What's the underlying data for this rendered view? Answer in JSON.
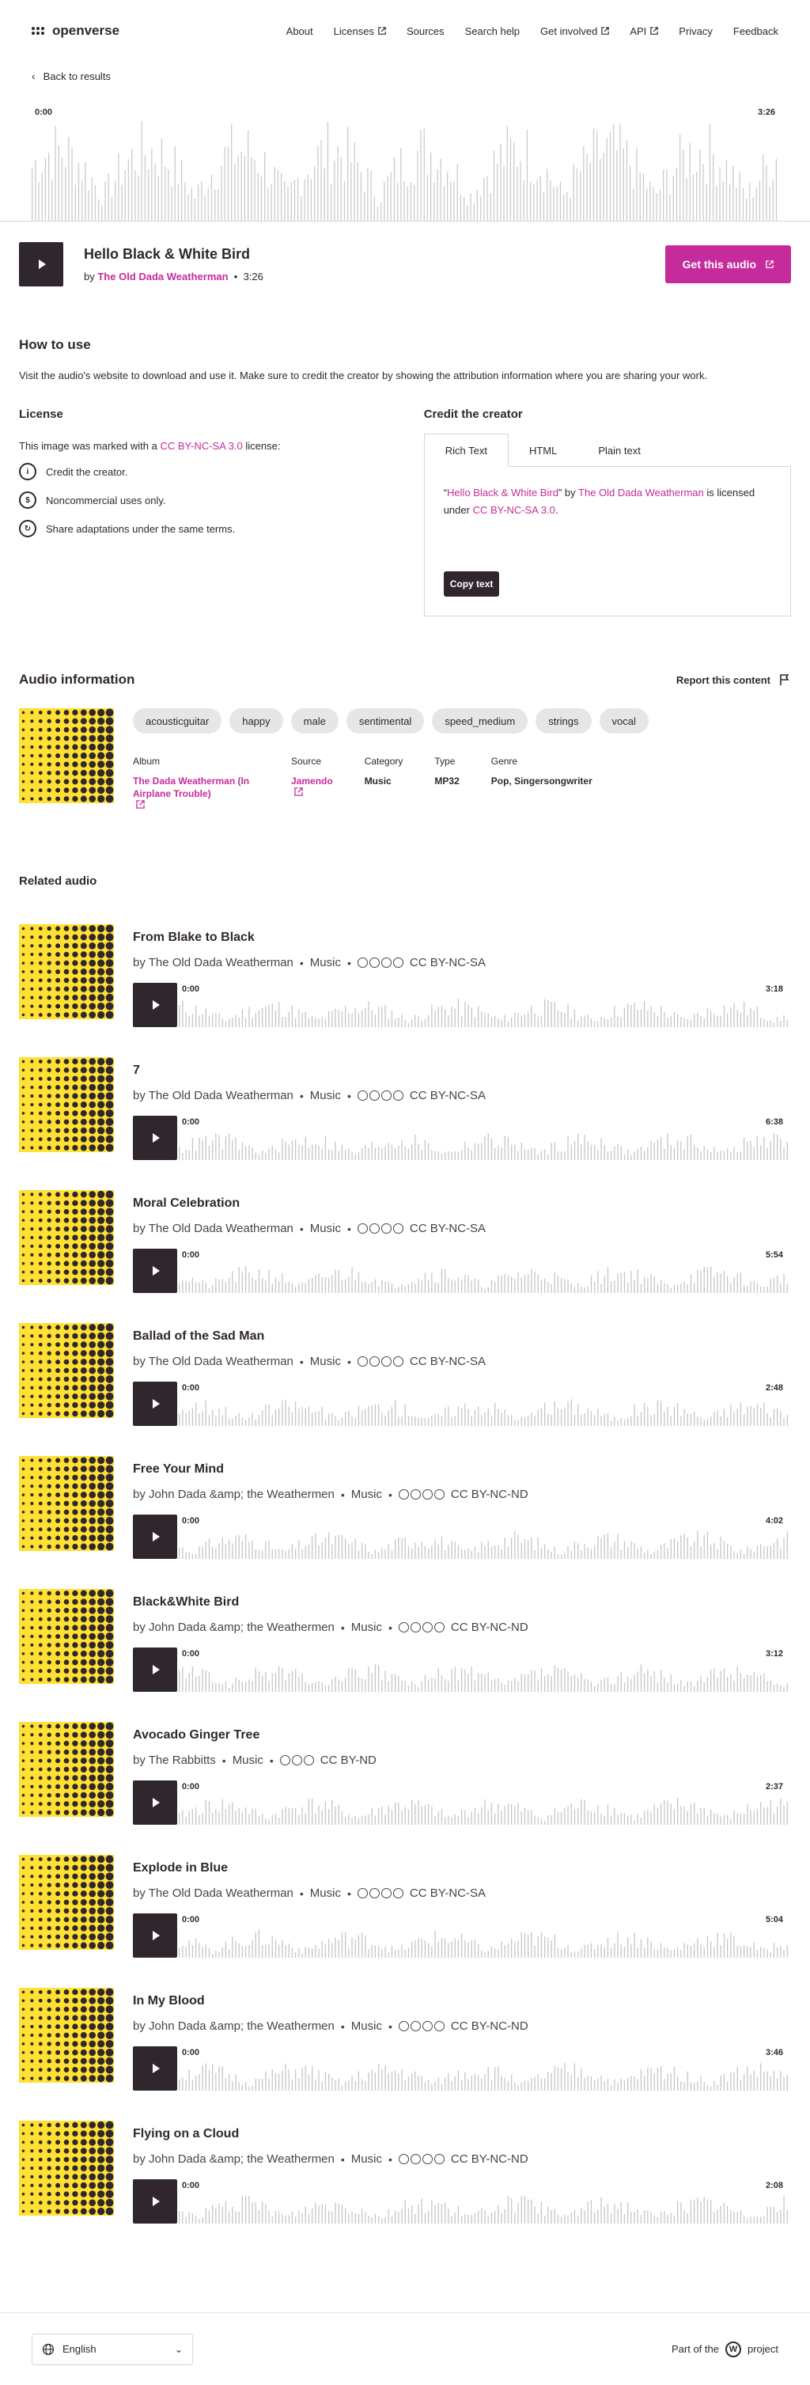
{
  "header": {
    "logo_text": "openverse",
    "nav": [
      {
        "label": "About",
        "external": false
      },
      {
        "label": "Licenses",
        "external": true
      },
      {
        "label": "Sources",
        "external": false
      },
      {
        "label": "Search help",
        "external": false
      },
      {
        "label": "Get involved",
        "external": true
      },
      {
        "label": "API",
        "external": true
      },
      {
        "label": "Privacy",
        "external": false
      },
      {
        "label": "Feedback",
        "external": false
      }
    ]
  },
  "back_label": "Back to results",
  "player": {
    "current_time": "0:00",
    "duration": "3:26"
  },
  "track": {
    "title": "Hello Black & White Bird",
    "by": "by",
    "creator": "The Old Dada Weatherman",
    "separator": "•",
    "duration": "3:26",
    "get_button": "Get this audio"
  },
  "how_to_use": {
    "heading": "How to use",
    "text": "Visit the audio's website to download and use it. Make sure to credit the creator by showing the attribution information where you are sharing your work."
  },
  "license": {
    "heading": "License",
    "text_before": "This image was marked with a",
    "license_name": "CC BY-NC-SA 3.0",
    "text_after": "license:",
    "terms": [
      {
        "icon": "by-icon",
        "glyph": "i",
        "text": "Credit the creator."
      },
      {
        "icon": "nc-icon",
        "glyph": "$",
        "text": "Noncommercial uses only."
      },
      {
        "icon": "sa-icon",
        "glyph": "↻",
        "text": "Share adaptations under the same terms."
      }
    ]
  },
  "credit": {
    "heading": "Credit the creator",
    "tabs": [
      "Rich Text",
      "HTML",
      "Plain text"
    ],
    "active_tab": "Rich Text",
    "quote_open": "“",
    "title": "Hello Black & White Bird",
    "quote_close": "”",
    "by": "by",
    "creator": "The Old Dada Weatherman",
    "licensed_under": "is licensed under",
    "license": "CC BY-NC-SA 3.0",
    "period": ".",
    "copy_button": "Copy text"
  },
  "audio_info": {
    "heading": "Audio information",
    "report": "Report this content",
    "tags": [
      "acousticguitar",
      "happy",
      "male",
      "sentimental",
      "speed_medium",
      "strings",
      "vocal"
    ],
    "meta": [
      {
        "label": "Album",
        "value": "The Dada Weatherman (In Airplane Trouble)",
        "link": true
      },
      {
        "label": "Source",
        "value": "Jamendo",
        "link": true
      },
      {
        "label": "Category",
        "value": "Music",
        "link": false
      },
      {
        "label": "Type",
        "value": "MP32",
        "link": false
      },
      {
        "label": "Genre",
        "value": "Pop, Singersongwriter",
        "link": false
      }
    ]
  },
  "related": {
    "heading": "Related audio",
    "items": [
      {
        "title": "From Blake to Black",
        "artist": "by The Old Dada Weatherman",
        "category": "Music",
        "license": "CC BY-NC-SA",
        "icons": 4,
        "start": "0:00",
        "duration": "3:18"
      },
      {
        "title": "7",
        "artist": "by The Old Dada Weatherman",
        "category": "Music",
        "license": "CC BY-NC-SA",
        "icons": 4,
        "start": "0:00",
        "duration": "6:38"
      },
      {
        "title": "Moral Celebration",
        "artist": "by The Old Dada Weatherman",
        "category": "Music",
        "license": "CC BY-NC-SA",
        "icons": 4,
        "start": "0:00",
        "duration": "5:54"
      },
      {
        "title": "Ballad of the Sad Man",
        "artist": "by The Old Dada Weatherman",
        "category": "Music",
        "license": "CC BY-NC-SA",
        "icons": 4,
        "start": "0:00",
        "duration": "2:48"
      },
      {
        "title": "Free Your Mind",
        "artist": "by John Dada &amp; the Weathermen",
        "category": "Music",
        "license": "CC BY-NC-ND",
        "icons": 4,
        "start": "0:00",
        "duration": "4:02"
      },
      {
        "title": "Black&White Bird",
        "artist": "by John Dada &amp; the Weathermen",
        "category": "Music",
        "license": "CC BY-NC-ND",
        "icons": 4,
        "start": "0:00",
        "duration": "3:12"
      },
      {
        "title": "Avocado Ginger Tree",
        "artist": "by The Rabbitts",
        "category": "Music",
        "license": "CC BY-ND",
        "icons": 3,
        "start": "0:00",
        "duration": "2:37"
      },
      {
        "title": "Explode in Blue",
        "artist": "by The Old Dada Weatherman",
        "category": "Music",
        "license": "CC BY-NC-SA",
        "icons": 4,
        "start": "0:00",
        "duration": "5:04"
      },
      {
        "title": "In My Blood",
        "artist": "by John Dada &amp; the Weathermen",
        "category": "Music",
        "license": "CC BY-NC-ND",
        "icons": 4,
        "start": "0:00",
        "duration": "3:46"
      },
      {
        "title": "Flying on a Cloud",
        "artist": "by John Dada &amp; the Weathermen",
        "category": "Music",
        "license": "CC BY-NC-ND",
        "icons": 4,
        "start": "0:00",
        "duration": "2:08"
      }
    ]
  },
  "footer": {
    "language": "English",
    "part_of": "Part of the",
    "project": "project"
  },
  "colors": {
    "accent": "#c52b9b",
    "dark": "#30272e",
    "art_yellow": "#ffe033"
  }
}
